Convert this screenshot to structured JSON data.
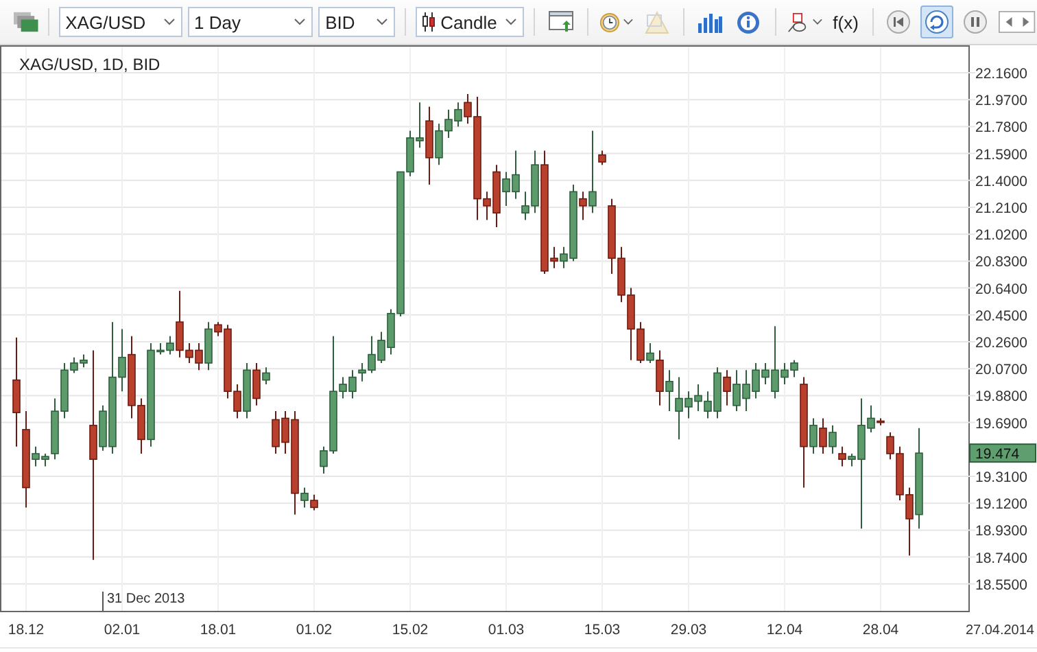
{
  "toolbar": {
    "selects": [
      {
        "kind": "plain",
        "value": "XAG/USD"
      },
      {
        "kind": "plain",
        "value": "1 Day"
      },
      {
        "kind": "plain",
        "value": "BID"
      },
      {
        "kind": "candle",
        "value": "Candle"
      }
    ],
    "tools": [
      {
        "kind": "window",
        "selected": false,
        "disabled": false
      },
      {
        "kind": "clock",
        "selected": false,
        "disabled": false
      },
      {
        "kind": "drawing",
        "selected": false,
        "disabled": true
      },
      {
        "kind": "bars",
        "selected": false,
        "disabled": false
      },
      {
        "kind": "info",
        "selected": false,
        "disabled": false
      },
      {
        "kind": "shapes",
        "selected": false,
        "disabled": false
      },
      {
        "kind": "function",
        "label": "f(x)",
        "selected": false,
        "disabled": false
      },
      {
        "kind": "rewind",
        "selected": false,
        "disabled": false
      },
      {
        "kind": "refresh",
        "selected": true,
        "disabled": false
      },
      {
        "kind": "pause",
        "selected": false,
        "disabled": false
      },
      {
        "kind": "nav",
        "selected": false,
        "disabled": false
      }
    ]
  },
  "chart": {
    "legend": "XAG/USD, 1D, BID",
    "marker_label": "31 Dec 2013",
    "axis_end_label": "27.04.2014",
    "last_price": "19.474",
    "chart_data": {
      "type": "candlestick",
      "grid": true,
      "ylim": [
        18.36,
        22.354
      ],
      "yticks": [
        {
          "value": 18.55,
          "label": "18.5500"
        },
        {
          "value": 18.74,
          "label": "18.7400"
        },
        {
          "value": 18.93,
          "label": "18.9300"
        },
        {
          "value": 19.12,
          "label": "19.1200"
        },
        {
          "value": 19.31,
          "label": "19.3100"
        },
        {
          "value": 19.69,
          "label": "19.6900"
        },
        {
          "value": 19.88,
          "label": "19.8800"
        },
        {
          "value": 20.07,
          "label": "20.0700"
        },
        {
          "value": 20.26,
          "label": "20.2600"
        },
        {
          "value": 20.45,
          "label": "20.4500"
        },
        {
          "value": 20.64,
          "label": "20.6400"
        },
        {
          "value": 20.83,
          "label": "20.8300"
        },
        {
          "value": 21.02,
          "label": "21.0200"
        },
        {
          "value": 21.21,
          "label": "21.2100"
        },
        {
          "value": 21.4,
          "label": "21.4000"
        },
        {
          "value": 21.59,
          "label": "21.5900"
        },
        {
          "value": 21.78,
          "label": "21.7800"
        },
        {
          "value": 21.97,
          "label": "21.9700"
        },
        {
          "value": 22.16,
          "label": "22.1600"
        }
      ],
      "categories": [
        null,
        "18.12",
        null,
        null,
        null,
        null,
        null,
        null,
        null,
        null,
        null,
        "02.01",
        null,
        null,
        null,
        null,
        null,
        null,
        null,
        null,
        null,
        "18.01",
        null,
        null,
        null,
        null,
        null,
        null,
        null,
        null,
        null,
        "01.02",
        null,
        null,
        null,
        null,
        null,
        null,
        null,
        null,
        null,
        "15.02",
        null,
        null,
        null,
        null,
        null,
        null,
        null,
        null,
        null,
        "01.03",
        null,
        null,
        null,
        null,
        null,
        null,
        null,
        null,
        null,
        "15.03",
        null,
        null,
        null,
        null,
        null,
        null,
        null,
        null,
        "29.03",
        null,
        null,
        null,
        null,
        null,
        null,
        null,
        null,
        null,
        "12.04",
        null,
        null,
        null,
        null,
        null,
        null,
        null,
        null,
        null,
        "28.04",
        null,
        null,
        null,
        null
      ],
      "ohlc": [
        [
          19.99,
          20.29,
          19.52,
          19.76
        ],
        [
          19.64,
          19.77,
          19.09,
          19.23
        ],
        [
          19.43,
          19.52,
          19.38,
          19.47
        ],
        [
          19.43,
          19.47,
          19.38,
          19.45
        ],
        [
          19.47,
          19.86,
          19.43,
          19.77
        ],
        [
          19.77,
          20.11,
          19.72,
          20.06
        ],
        [
          20.06,
          20.15,
          20.04,
          20.11
        ],
        [
          20.11,
          20.17,
          20.08,
          20.13
        ],
        [
          19.67,
          20.2,
          18.72,
          19.43
        ],
        [
          19.52,
          19.81,
          19.49,
          19.77
        ],
        [
          19.52,
          20.4,
          19.47,
          20.01
        ],
        [
          20.01,
          20.35,
          19.91,
          20.15
        ],
        [
          20.17,
          20.3,
          19.72,
          19.81
        ],
        [
          19.81,
          19.86,
          19.47,
          19.57
        ],
        [
          19.57,
          20.25,
          19.52,
          20.2
        ],
        [
          20.19,
          20.25,
          20.17,
          20.2
        ],
        [
          20.2,
          20.3,
          20.17,
          20.25
        ],
        [
          20.4,
          20.62,
          20.15,
          20.2
        ],
        [
          20.2,
          20.25,
          20.11,
          20.15
        ],
        [
          20.2,
          20.25,
          20.06,
          20.11
        ],
        [
          20.11,
          20.4,
          20.06,
          20.35
        ],
        [
          20.38,
          20.4,
          20.3,
          20.33
        ],
        [
          20.35,
          20.38,
          19.86,
          19.91
        ],
        [
          19.91,
          19.96,
          19.72,
          19.77
        ],
        [
          19.77,
          20.11,
          19.72,
          20.06
        ],
        [
          20.06,
          20.11,
          19.81,
          19.86
        ],
        [
          19.99,
          20.08,
          19.96,
          20.04
        ],
        [
          19.71,
          19.77,
          19.47,
          19.52
        ],
        [
          19.72,
          19.77,
          19.47,
          19.55
        ],
        [
          19.71,
          19.77,
          19.04,
          19.19
        ],
        [
          19.14,
          19.23,
          19.09,
          19.19
        ],
        [
          19.14,
          19.18,
          19.07,
          19.09
        ],
        [
          19.38,
          19.52,
          19.33,
          19.49
        ],
        [
          19.49,
          20.3,
          19.47,
          19.91
        ],
        [
          19.91,
          20.01,
          19.86,
          19.96
        ],
        [
          19.91,
          20.06,
          19.86,
          20.01
        ],
        [
          20.04,
          20.11,
          19.98,
          20.06
        ],
        [
          20.06,
          20.3,
          20.04,
          20.17
        ],
        [
          20.13,
          20.33,
          20.11,
          20.27
        ],
        [
          20.22,
          20.49,
          20.17,
          20.46
        ],
        [
          20.46,
          21.46,
          20.44,
          21.46
        ],
        [
          21.46,
          21.75,
          21.43,
          21.7
        ],
        [
          21.68,
          21.95,
          21.63,
          21.7
        ],
        [
          21.82,
          21.92,
          21.37,
          21.56
        ],
        [
          21.56,
          21.8,
          21.51,
          21.75
        ],
        [
          21.75,
          21.9,
          21.7,
          21.83
        ],
        [
          21.82,
          21.95,
          21.78,
          21.9
        ],
        [
          21.95,
          22.01,
          21.8,
          21.85
        ],
        [
          21.85,
          21.99,
          21.12,
          21.27
        ],
        [
          21.27,
          21.32,
          21.12,
          21.22
        ],
        [
          21.46,
          21.51,
          21.07,
          21.17
        ],
        [
          21.32,
          21.46,
          21.22,
          21.41
        ],
        [
          21.32,
          21.61,
          21.27,
          21.44
        ],
        [
          21.17,
          21.32,
          21.12,
          21.22
        ],
        [
          21.22,
          21.61,
          21.17,
          21.51
        ],
        [
          21.51,
          21.61,
          20.74,
          20.76
        ],
        [
          20.85,
          20.93,
          20.78,
          20.83
        ],
        [
          20.83,
          20.93,
          20.78,
          20.88
        ],
        [
          20.85,
          21.37,
          20.83,
          21.32
        ],
        [
          21.27,
          21.32,
          21.12,
          21.22
        ],
        [
          21.22,
          21.75,
          21.17,
          21.32
        ],
        [
          21.58,
          21.61,
          21.51,
          21.53
        ],
        [
          21.22,
          21.27,
          20.74,
          20.85
        ],
        [
          20.85,
          20.93,
          20.54,
          20.59
        ],
        [
          20.59,
          20.64,
          20.13,
          20.35
        ],
        [
          20.35,
          20.4,
          20.11,
          20.13
        ],
        [
          20.13,
          20.25,
          20.11,
          20.18
        ],
        [
          20.13,
          20.2,
          19.81,
          19.91
        ],
        [
          19.91,
          20.06,
          19.77,
          19.98
        ],
        [
          19.77,
          20.01,
          19.57,
          19.86
        ],
        [
          19.8,
          19.91,
          19.72,
          19.86
        ],
        [
          19.84,
          19.96,
          19.77,
          19.88
        ],
        [
          19.77,
          19.91,
          19.72,
          19.84
        ],
        [
          19.77,
          20.08,
          19.72,
          20.04
        ],
        [
          20.01,
          20.06,
          19.81,
          19.91
        ],
        [
          19.81,
          20.06,
          19.77,
          19.96
        ],
        [
          19.86,
          20.06,
          19.77,
          19.96
        ],
        [
          19.91,
          20.11,
          19.86,
          20.06
        ],
        [
          20.01,
          20.11,
          19.96,
          20.06
        ],
        [
          19.91,
          20.37,
          19.86,
          20.06
        ],
        [
          20.01,
          20.11,
          19.96,
          20.06
        ],
        [
          20.06,
          20.13,
          20.01,
          20.11
        ],
        [
          19.96,
          20.01,
          19.23,
          19.52
        ],
        [
          19.52,
          19.72,
          19.47,
          19.67
        ],
        [
          19.65,
          19.72,
          19.47,
          19.52
        ],
        [
          19.52,
          19.67,
          19.47,
          19.62
        ],
        [
          19.47,
          19.52,
          19.38,
          19.43
        ],
        [
          19.43,
          19.47,
          19.38,
          19.45
        ],
        [
          19.43,
          19.86,
          18.94,
          19.67
        ],
        [
          19.65,
          19.81,
          19.62,
          19.72
        ],
        [
          19.7,
          19.72,
          19.67,
          19.69
        ],
        [
          19.59,
          19.62,
          19.43,
          19.47
        ],
        [
          19.47,
          19.52,
          19.14,
          19.18
        ],
        [
          19.18,
          19.23,
          18.75,
          19.01
        ],
        [
          19.04,
          19.65,
          18.94,
          19.474
        ]
      ]
    }
  }
}
